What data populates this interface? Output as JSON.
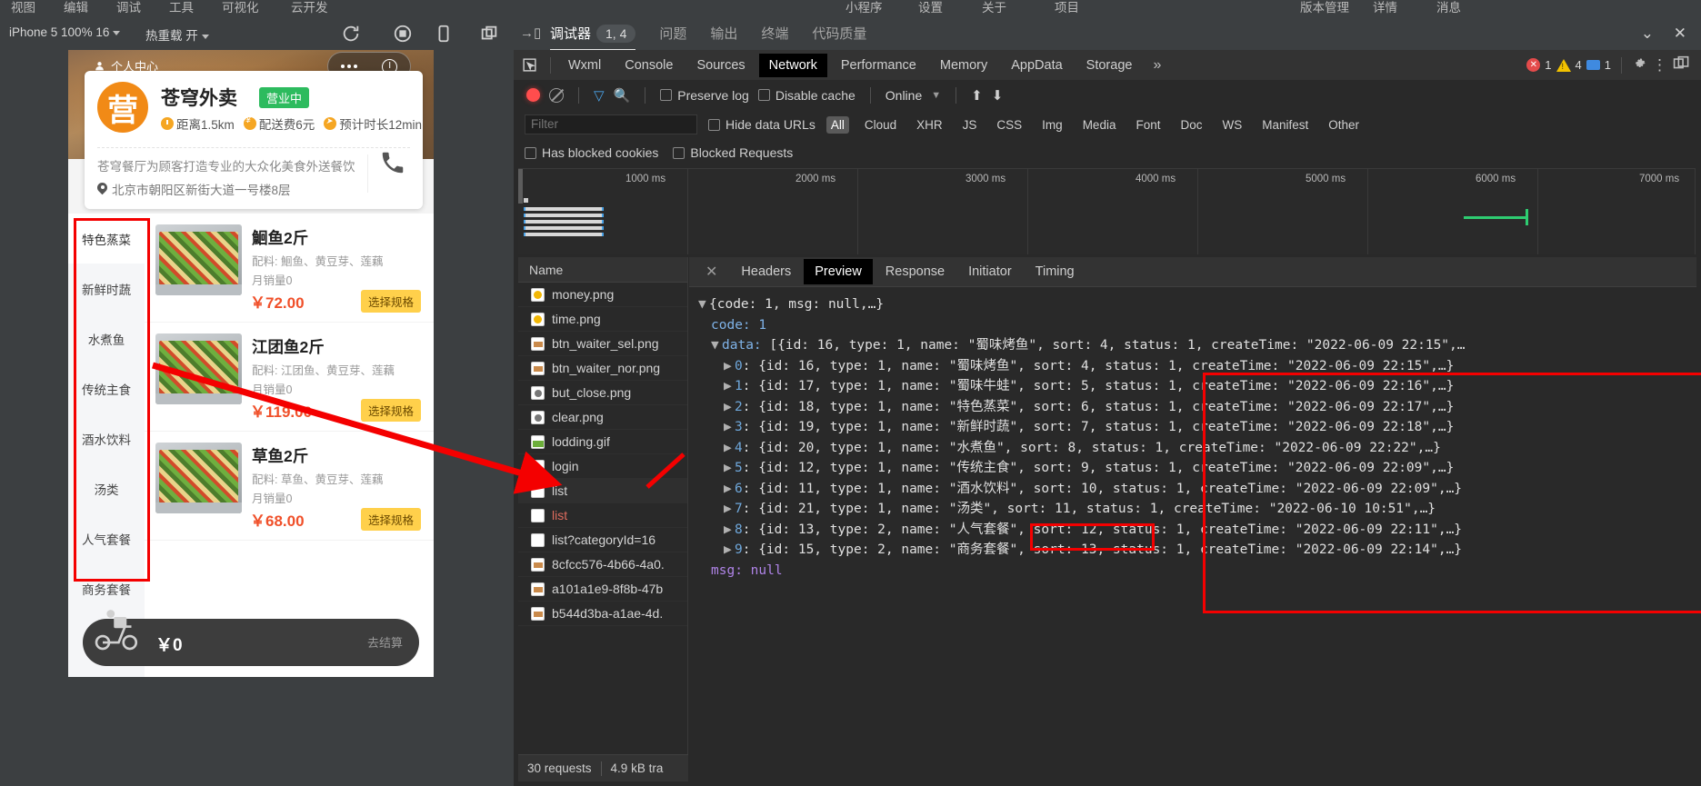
{
  "top_menu": [
    "视图",
    "编辑",
    "调试",
    "工具",
    "可视化",
    "云开发",
    "小程序",
    "设置",
    "关于",
    "项目",
    "版本管理",
    "详情",
    "消息"
  ],
  "simulator": {
    "device_label": "iPhone 5 100% 16",
    "hotreload_label": "热重载 开",
    "icons": [
      "refresh-icon",
      "stop-icon",
      "phone-icon",
      "copy-icon"
    ],
    "phone": {
      "nav_title": "个人中心",
      "shop": {
        "logo_text": "营",
        "name": "苍穹外卖",
        "status_badge": "营业中",
        "distance": "距离1.5km",
        "delivery_fee": "配送费6元",
        "eta": "预计时长12min",
        "description": "苍穹餐厅为顾客打造专业的大众化美食外送餐饮",
        "address": "北京市朝阳区新街大道一号楼8层"
      },
      "categories": [
        "特色蒸菜",
        "新鲜时蔬",
        "水煮鱼",
        "传统主食",
        "酒水饮料",
        "汤类",
        "人气套餐",
        "商务套餐"
      ],
      "selected_category": "特色蒸菜",
      "dishes": [
        {
          "name": "鮰鱼2斤",
          "ingredients": "配料: 鮰鱼、黄豆芽、莲藕",
          "sales": "月销量0",
          "price": "￥72.00",
          "spec_button": "选择规格"
        },
        {
          "name": "江团鱼2斤",
          "ingredients": "配料: 江团鱼、黄豆芽、莲藕",
          "sales": "月销量0",
          "price": "￥119.00",
          "spec_button": "选择规格"
        },
        {
          "name": "草鱼2斤",
          "ingredients": "配料: 草鱼、黄豆芽、莲藕",
          "sales": "月销量0",
          "price": "￥68.00",
          "spec_button": "选择规格"
        }
      ],
      "cart": {
        "amount": "￥0",
        "checkout_label": "去结算"
      }
    }
  },
  "devtools": {
    "tabs": [
      {
        "label": "调试器",
        "count": "1, 4",
        "active": true
      },
      {
        "label": "问题",
        "active": false
      },
      {
        "label": "输出",
        "active": false
      },
      {
        "label": "终端",
        "active": false
      },
      {
        "label": "代码质量",
        "active": false
      }
    ],
    "window_controls": [
      "chevron-down-icon",
      "close-icon"
    ],
    "panel_tabs": [
      "Wxml",
      "Console",
      "Sources",
      "Network",
      "Performance",
      "Memory",
      "AppData",
      "Storage"
    ],
    "panel_tab_active": "Network",
    "overflow_label": "»",
    "badges": {
      "errors": "1",
      "warnings": "4",
      "infos": "1"
    },
    "network_toolbar": {
      "preserve_log": "Preserve log",
      "disable_cache": "Disable cache",
      "throttle": "Online"
    },
    "filter": {
      "placeholder": "Filter",
      "hide_data_urls": "Hide data URLs",
      "types": [
        "All",
        "Cloud",
        "XHR",
        "JS",
        "CSS",
        "Img",
        "Media",
        "Font",
        "Doc",
        "WS",
        "Manifest",
        "Other"
      ],
      "active_type": "All",
      "has_blocked_cookies": "Has blocked cookies",
      "blocked_requests": "Blocked Requests"
    },
    "timeline_ticks": [
      "1000 ms",
      "2000 ms",
      "3000 ms",
      "4000 ms",
      "5000 ms",
      "6000 ms",
      "7000 ms"
    ],
    "name_column_header": "Name",
    "requests": [
      {
        "name": "money.png",
        "icon": "png-file-icon",
        "kind": "png",
        "red": false,
        "selected": false
      },
      {
        "name": "time.png",
        "icon": "png-file-icon",
        "kind": "png",
        "red": false,
        "selected": false
      },
      {
        "name": "btn_waiter_sel.png",
        "icon": "png-file-icon",
        "kind": "food",
        "red": false,
        "selected": false
      },
      {
        "name": "btn_waiter_nor.png",
        "icon": "png-file-icon",
        "kind": "food",
        "red": false,
        "selected": false
      },
      {
        "name": "but_close.png",
        "icon": "png-file-icon",
        "kind": "gray",
        "red": false,
        "selected": false
      },
      {
        "name": "clear.png",
        "icon": "png-file-icon",
        "kind": "gray",
        "red": false,
        "selected": false
      },
      {
        "name": "lodding.gif",
        "icon": "gif-file-icon",
        "kind": "img",
        "red": false,
        "selected": false
      },
      {
        "name": "login",
        "icon": "doc-file-icon",
        "kind": "doc",
        "red": false,
        "selected": false
      },
      {
        "name": "list",
        "icon": "doc-file-icon",
        "kind": "doc",
        "red": false,
        "selected": true
      },
      {
        "name": "list",
        "icon": "doc-file-icon",
        "kind": "doc",
        "red": true,
        "selected": false
      },
      {
        "name": "list?categoryId=16",
        "icon": "doc-file-icon",
        "kind": "doc",
        "red": false,
        "selected": false
      },
      {
        "name": "8cfcc576-4b66-4a0.",
        "icon": "img-file-icon",
        "kind": "food",
        "red": false,
        "selected": false
      },
      {
        "name": "a101a1e9-8f8b-47b",
        "icon": "img-file-icon",
        "kind": "food",
        "red": false,
        "selected": false
      },
      {
        "name": "b544d3ba-a1ae-4d.",
        "icon": "img-file-icon",
        "kind": "food",
        "red": false,
        "selected": false
      }
    ],
    "status": {
      "requests": "30 requests",
      "transferred": "4.9 kB tra"
    },
    "detail_tabs": [
      "Headers",
      "Preview",
      "Response",
      "Initiator",
      "Timing"
    ],
    "detail_tab_active": "Preview",
    "preview": {
      "root_line": "{code: 1, msg: null,…}",
      "code_line": "code: 1",
      "data_key": "data:",
      "data_summary": "[{id: 16, type: 1, name: \"蜀味烤鱼\", sort: 4, status: 1, createTime: \"2022-06-09 22:15\",…",
      "msg_key": "msg:",
      "msg_value": "null",
      "items": [
        {
          "index": "0",
          "text": "{id: 16, type: 1, name: \"蜀味烤鱼\", sort: 4, status: 1, createTime: \"2022-06-09 22:15\",…}"
        },
        {
          "index": "1",
          "text": "{id: 17, type: 1, name: \"蜀味牛蛙\", sort: 5, status: 1, createTime: \"2022-06-09 22:16\",…}"
        },
        {
          "index": "2",
          "text": "{id: 18, type: 1, name: \"特色蒸菜\", sort: 6, status: 1, createTime: \"2022-06-09 22:17\",…}"
        },
        {
          "index": "3",
          "text": "{id: 19, type: 1, name: \"新鲜时蔬\", sort: 7, status: 1, createTime: \"2022-06-09 22:18\",…}"
        },
        {
          "index": "4",
          "text": "{id: 20, type: 1, name: \"水煮鱼\", sort: 8, status: 1, createTime: \"2022-06-09 22:22\",…}"
        },
        {
          "index": "5",
          "text": "{id: 12, type: 1, name: \"传统主食\", sort: 9, status: 1, createTime: \"2022-06-09 22:09\",…}"
        },
        {
          "index": "6",
          "text": "{id: 11, type: 1, name: \"酒水饮料\", sort: 10, status: 1, createTime: \"2022-06-09 22:09\",…}"
        },
        {
          "index": "7",
          "text": "{id: 21, type: 1, name: \"汤类\", sort: 11, status: 1, createTime: \"2022-06-10 10:51\",…}"
        },
        {
          "index": "8",
          "text": "{id: 13, type: 2, name: \"人气套餐\", sort: 12, status: 1, createTime: \"2022-06-09 22:11\",…}"
        },
        {
          "index": "9",
          "text": "{id: 15, type: 2, name: \"商务套餐\", sort: 13, status: 1, createTime: \"2022-06-09 22:14\",…}"
        }
      ]
    }
  },
  "annotations": {
    "highlight_color": "#f40000"
  }
}
